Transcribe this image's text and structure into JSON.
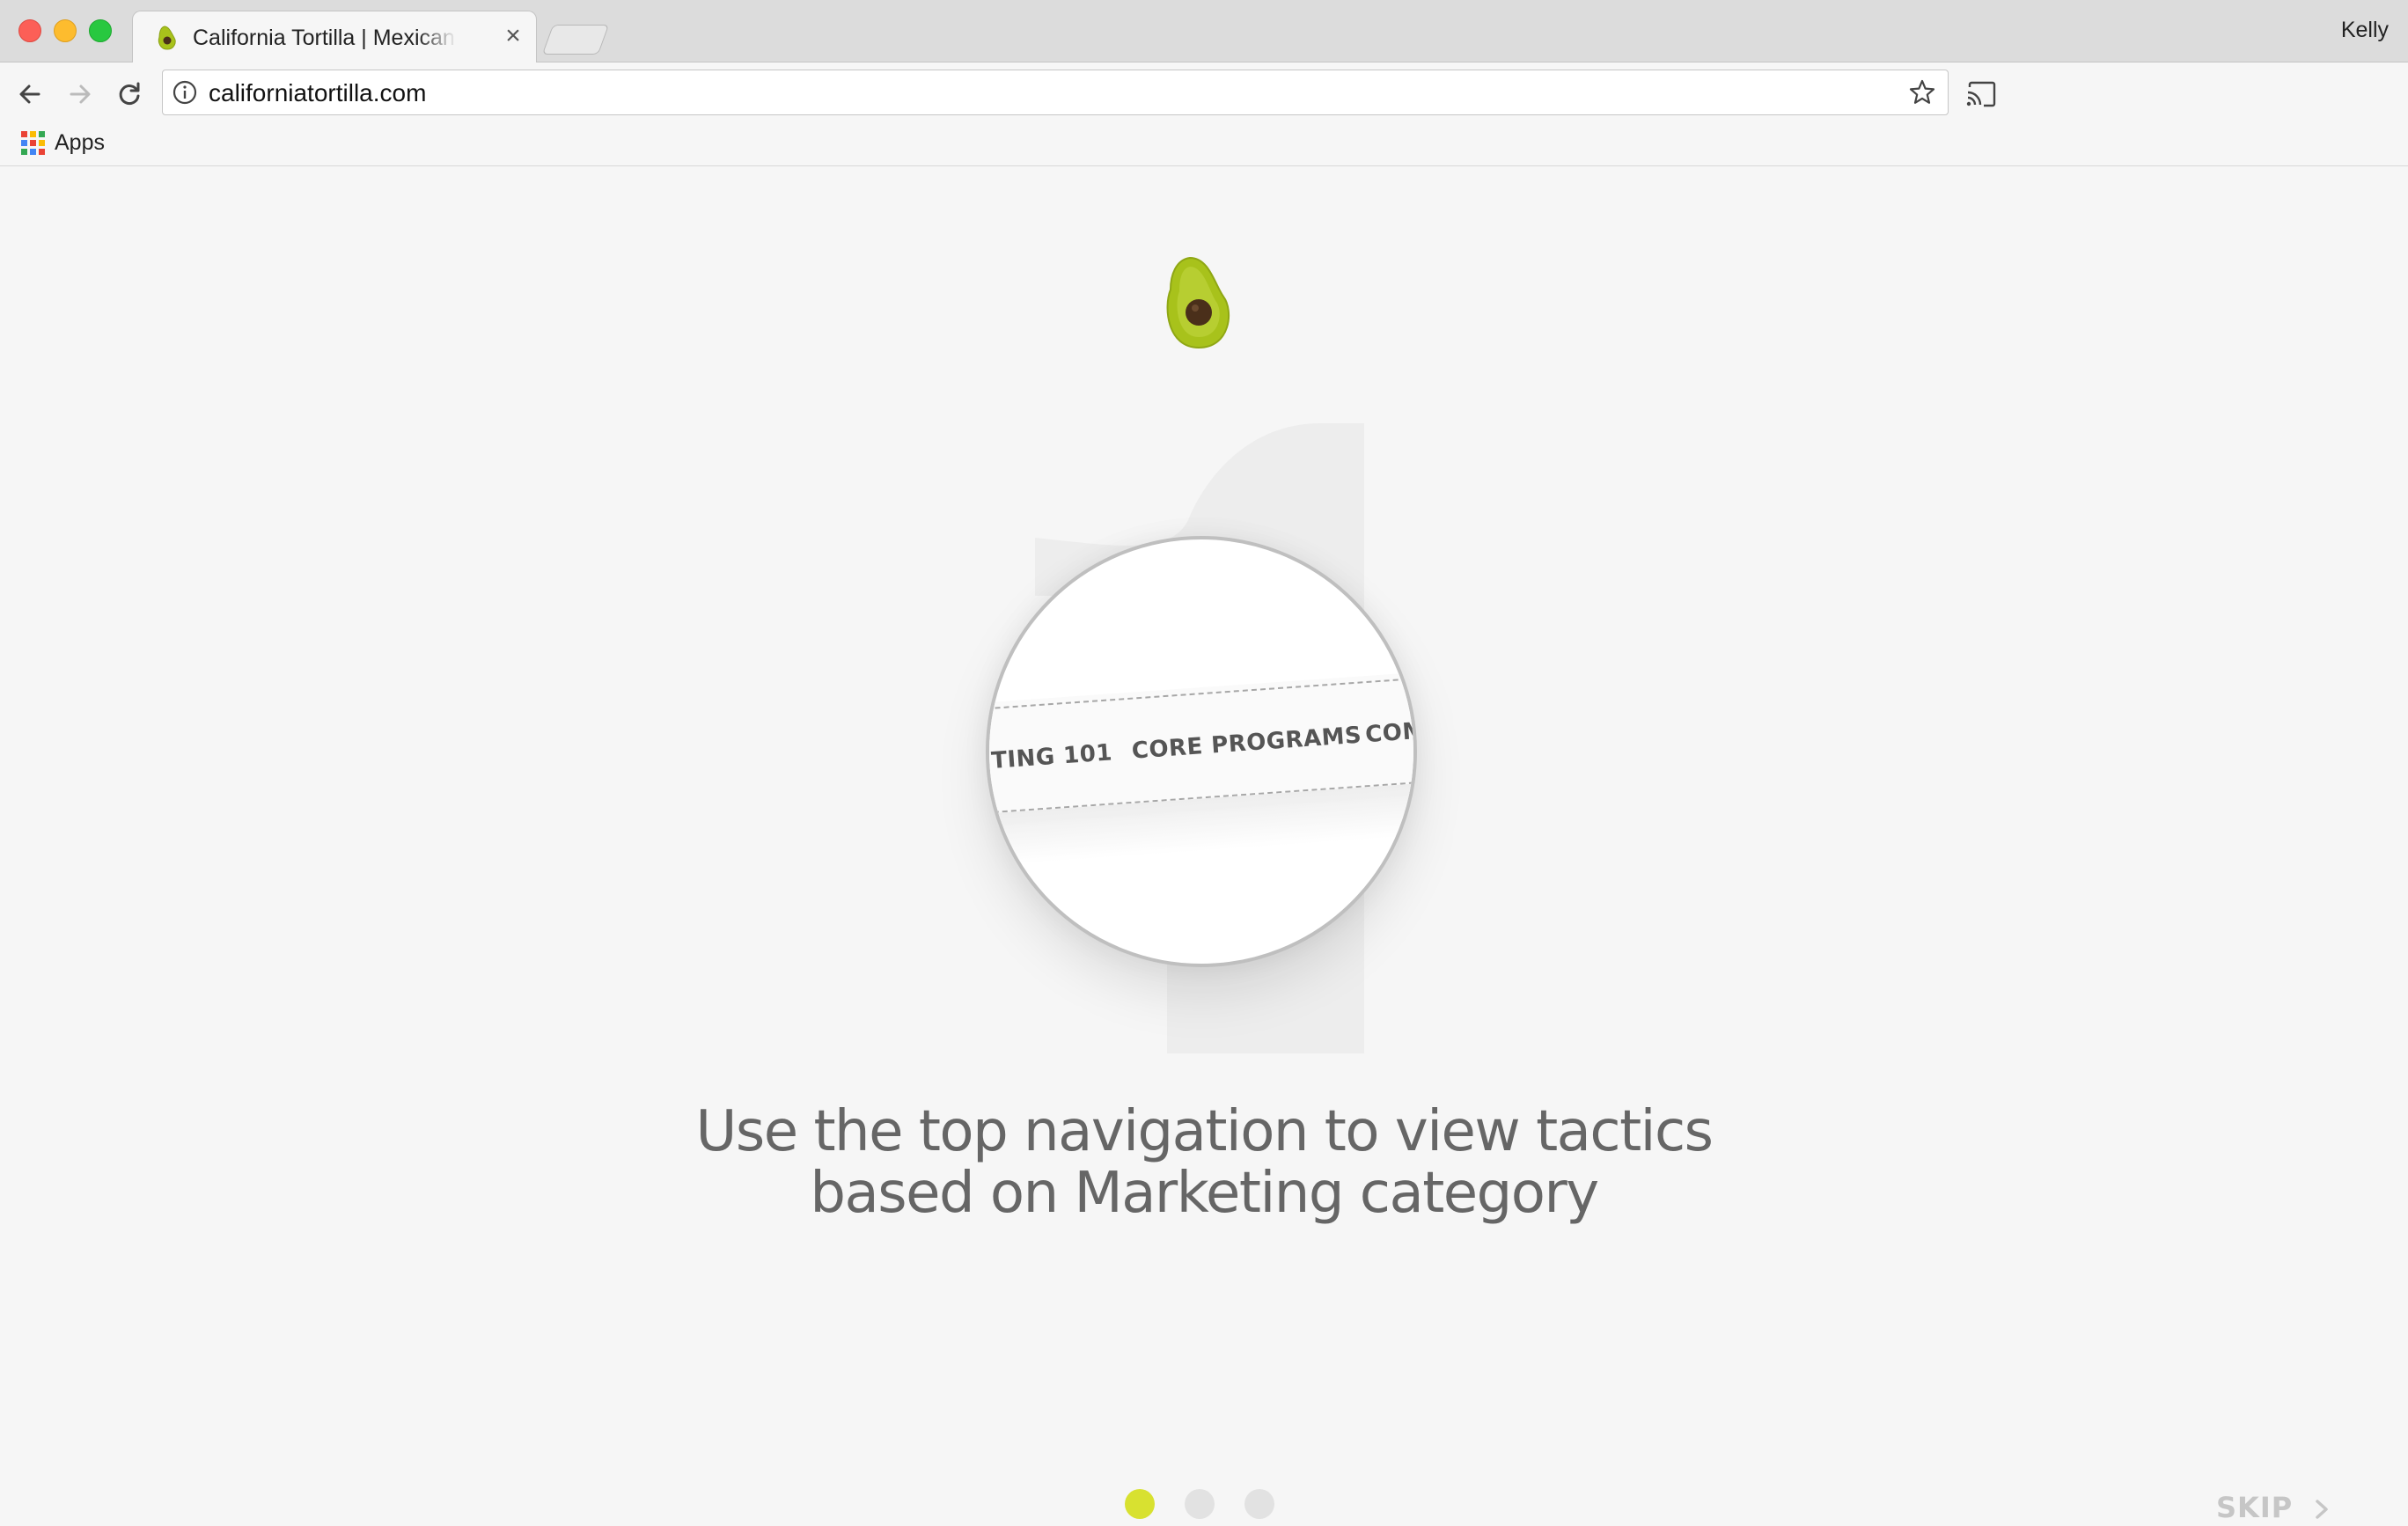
{
  "browser": {
    "tab_title": "California Tortilla | Mexican Food",
    "profile_name": "Kelly",
    "url": "californiatortilla.com",
    "bookmarks": [
      {
        "label": "Apps"
      }
    ]
  },
  "page": {
    "headline_line1": "Use the top navigation to view tactics",
    "headline_line2": "based on Marketing category",
    "lens_nav_items": [
      "TING 101",
      "CORE PROGRAMS",
      "COM"
    ],
    "big_number": "1",
    "skip_label": "SKIP",
    "pager": {
      "total": 3,
      "active": 1
    },
    "colors": {
      "accent": "#d8e130",
      "avocado_green": "#a8c21b",
      "avocado_pit": "#4a2f1a",
      "inactive_dot": "#e2e2e2",
      "headline": "#666666",
      "skip": "#c6c6c6"
    }
  },
  "icons": {
    "back": "back-arrow-icon",
    "forward": "forward-arrow-icon",
    "reload": "reload-icon",
    "info": "info-icon",
    "star": "star-icon",
    "cast": "cast-icon",
    "apps": "apps-grid-icon",
    "favicon": "avocado-icon",
    "close": "close-icon",
    "chevron": "chevron-right-icon"
  }
}
